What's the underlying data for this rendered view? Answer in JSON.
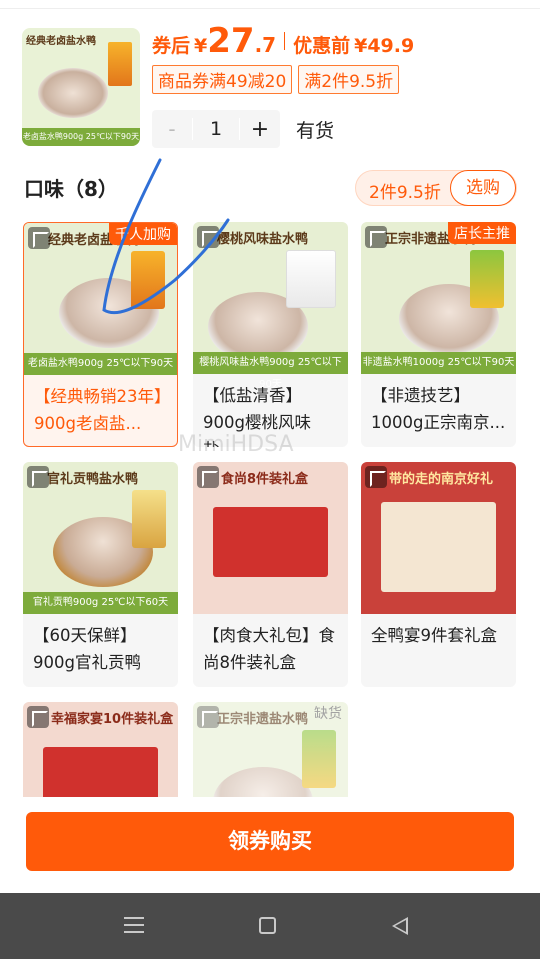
{
  "header": {
    "price_label": "券后",
    "yen": "¥",
    "price_int": "27",
    "price_dec": ".7",
    "orig_label": "优惠前",
    "orig_price": "¥49.9",
    "coupons": [
      "商品券满49减20",
      "满2件9.5折"
    ],
    "stepper": {
      "minus": "-",
      "qty": "1",
      "plus": "+"
    },
    "stock": "有货",
    "thumb": {
      "title": "经典老卤盐水鸭",
      "footer": "老卤盐水鸭900g  25℃以下90天"
    }
  },
  "flavor": {
    "title": "口味（8）",
    "promo": "2件9.5折",
    "promo_button": "选购"
  },
  "items": [
    {
      "name": "【经典畅销23年】900g老卤盐...",
      "badge": "千人加购",
      "banner": "经典老卤盐水鸭",
      "footer": "老卤盐水鸭900g  25℃以下90天",
      "selected": true
    },
    {
      "name": "【低盐清香】900g樱桃风味盐...",
      "badge": "",
      "banner": "樱桃风味盐水鸭",
      "footer": "樱桃风味盐水鸭900g  25℃以下90天",
      "selected": false
    },
    {
      "name": "【非遗技艺】1000g正宗南京...",
      "badge": "店长主推",
      "banner": "正宗非遗盐水鸭",
      "footer": "非遗盐水鸭1000g  25℃以下90天",
      "selected": false
    },
    {
      "name": "【60天保鲜】900g官礼贡鸭",
      "badge": "",
      "banner": "官礼贡鸭盐水鸭",
      "footer": "官礼贡鸭900g  25℃以下60天",
      "selected": false
    },
    {
      "name": "【肉食大礼包】食尚8件装礼盒",
      "badge": "",
      "banner": "食尚8件装礼盒",
      "footer": "",
      "selected": false
    },
    {
      "name": "全鸭宴9件套礼盒",
      "badge": "",
      "banner": "带的走的南京好礼",
      "footer": "",
      "selected": false
    },
    {
      "name": "",
      "badge": "",
      "banner": "幸福家宴10件装礼盒",
      "footer": "",
      "selected": false
    },
    {
      "name": "",
      "badge": "缺货",
      "banner": "正宗非遗盐水鸭",
      "footer": "",
      "selected": false
    }
  ],
  "cta": "领券购买",
  "watermark": "MimiHDSA",
  "colors": {
    "accent": "#ff5a0a",
    "navbar": "#4a4a4a"
  }
}
